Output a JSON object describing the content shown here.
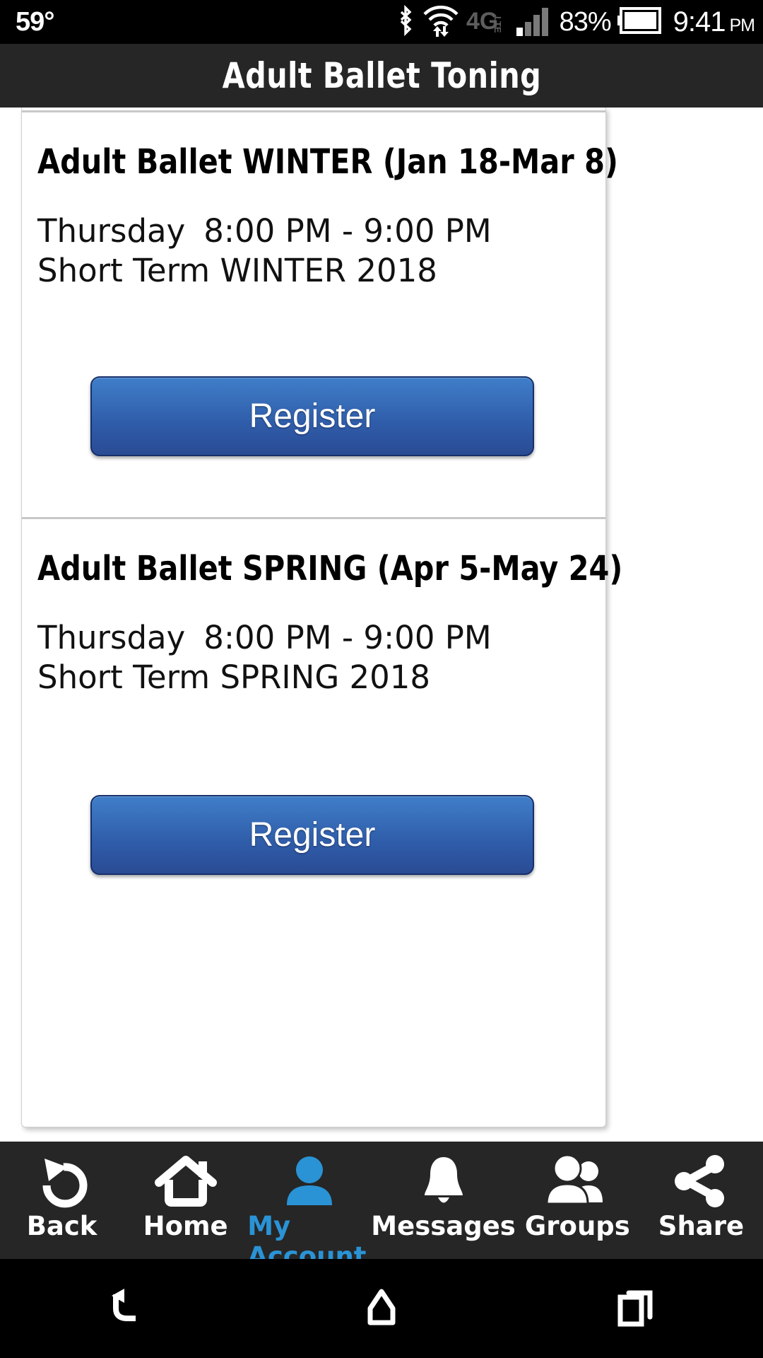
{
  "status_bar": {
    "temperature": "59°",
    "battery_percent": "83%",
    "time": "9:41",
    "ampm": "PM",
    "network_label": "4G",
    "network_sub": "LTE",
    "icons": [
      "bluetooth-icon",
      "wifi-icon",
      "data-transfer-icon",
      "lte-icon",
      "signal-bars-icon",
      "battery-icon"
    ]
  },
  "header": {
    "title": "Adult Ballet Toning"
  },
  "classes": [
    {
      "title": "Adult Ballet WINTER (Jan 18-Mar 8)",
      "day": "Thursday",
      "time": "8:00 PM - 9:00 PM",
      "term": "Short Term WINTER 2018",
      "meta_line_1": "Thursday",
      "meta_line_2": "8:00 PM - 9:00 PM",
      "meta_line_3": "Short Term WINTER 2018",
      "register_label": "Register"
    },
    {
      "title": "Adult Ballet SPRING (Apr 5-May 24)",
      "day": "Thursday",
      "time": "8:00 PM - 9:00 PM",
      "term": "Short Term SPRING 2018",
      "meta_line_1": "Thursday",
      "meta_line_2": "8:00 PM - 9:00 PM",
      "meta_line_3": "Short Term SPRING 2018",
      "register_label": "Register"
    }
  ],
  "bottom_nav": {
    "active_index": 2,
    "items": [
      {
        "label": "Back",
        "icon": "undo-arrow-icon"
      },
      {
        "label": "Home",
        "icon": "house-icon"
      },
      {
        "label": "My Account",
        "icon": "person-icon"
      },
      {
        "label": "Messages",
        "icon": "bell-icon"
      },
      {
        "label": "Groups",
        "icon": "people-group-icon"
      },
      {
        "label": "Share",
        "icon": "share-nodes-icon"
      }
    ]
  },
  "system_nav": {
    "items": [
      {
        "name": "back-button",
        "icon": "system-back-icon"
      },
      {
        "name": "home-button",
        "icon": "system-home-icon"
      },
      {
        "name": "recents-button",
        "icon": "system-recents-icon"
      }
    ]
  },
  "colors": {
    "accent_blue": "#2a93d5",
    "button_top": "#3f7ec9",
    "button_bottom": "#2a4b94",
    "header_bg": "#262626",
    "status_bg": "#000000"
  }
}
